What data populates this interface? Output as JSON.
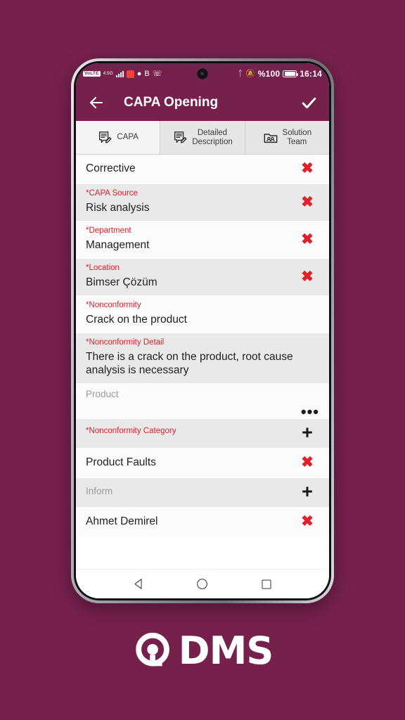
{
  "background_color": "#76214c",
  "brand_color": "#76214c",
  "accent_red": "#e0202a",
  "statusbar": {
    "carrier_chip": "VoLTE",
    "network_type": "4.5G",
    "icons_left": [
      "volte-chip",
      "network-4-5g",
      "signal-bars",
      "youtube-icon",
      "chat-bubble-icon",
      "gmail-icon",
      "whatsapp-icon"
    ],
    "bluetooth_icon": "bluetooth-icon",
    "mute_icon": "mute-bell-icon",
    "battery_percent": "%100",
    "time": "16:14"
  },
  "appbar": {
    "back_icon": "arrow-left-icon",
    "title": "CAPA Opening",
    "confirm_icon": "checkmark-icon"
  },
  "tabs": [
    {
      "label": "CAPA",
      "icon": "document-pencil-icon",
      "active": true
    },
    {
      "label": "Detailed\nDescription",
      "icon": "document-pencil-icon",
      "active": false
    },
    {
      "label": "Solution\nTeam",
      "icon": "folder-people-icon",
      "active": false
    }
  ],
  "form_rows": [
    {
      "label": "",
      "value": "Corrective",
      "placeholder": false,
      "action": "x",
      "shade": false
    },
    {
      "label": "*CAPA Source",
      "value": "Risk analysis",
      "placeholder": false,
      "action": "x",
      "shade": true
    },
    {
      "label": "*Department",
      "value": "Management",
      "placeholder": false,
      "action": "x",
      "shade": false
    },
    {
      "label": "*Location",
      "value": "Bimser Çözüm",
      "placeholder": false,
      "action": "x",
      "shade": true
    },
    {
      "label": "*Nonconformity",
      "value": "Crack on the product",
      "placeholder": false,
      "action": "none",
      "shade": false
    },
    {
      "label": "*Nonconformity Detail",
      "value": "There is a crack on the product, root cause analysis is necessary",
      "placeholder": false,
      "action": "none",
      "shade": true
    },
    {
      "label": "",
      "value": "Product",
      "placeholder": true,
      "action": "dots",
      "shade": false
    },
    {
      "label": "*Nonconformity Category",
      "value": "",
      "placeholder": false,
      "action": "plus",
      "shade": true
    },
    {
      "label": "",
      "value": "Product Faults",
      "placeholder": false,
      "action": "x",
      "shade": false
    },
    {
      "label": "",
      "value": "Inform",
      "placeholder": true,
      "action": "plus",
      "shade": true
    },
    {
      "label": "",
      "value": "Ahmet Demirel",
      "placeholder": false,
      "action": "x",
      "shade": false
    }
  ],
  "navbar": {
    "back": "triangle-back-icon",
    "home": "circle-home-icon",
    "recents": "square-recents-icon"
  },
  "logo": {
    "mark": "q-ring-icon",
    "wordmark": "DMS"
  }
}
